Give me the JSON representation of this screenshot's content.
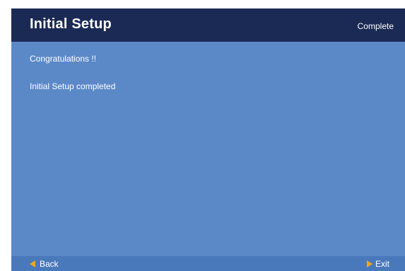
{
  "header": {
    "title": "Initial Setup",
    "step": "Complete"
  },
  "content": {
    "congrats": "Congratulations !!",
    "message": "Initial Setup completed"
  },
  "footer": {
    "back_label": "Back",
    "back_icon": "triangle-left-icon",
    "exit_label": "Exit",
    "exit_icon": "triangle-right-icon"
  },
  "colors": {
    "header_bg": "#1b2a55",
    "body_bg": "#5b89c8",
    "footer_bg": "#4a79bb",
    "accent": "#f3a31e",
    "text": "#ffffff"
  }
}
